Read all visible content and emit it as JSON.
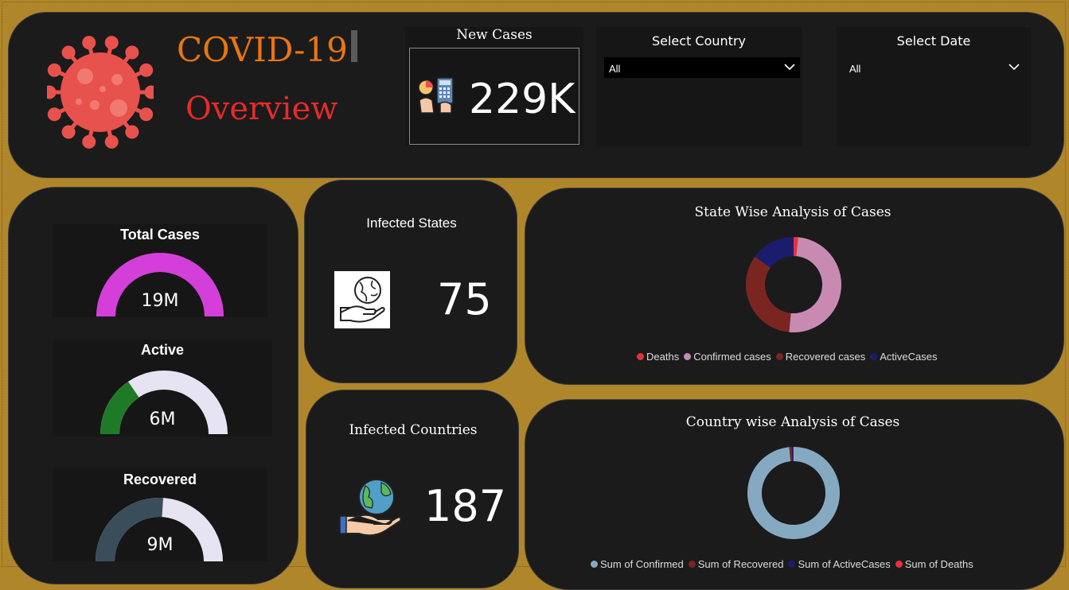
{
  "header": {
    "title": "COVID-19",
    "subtitle": "Overview",
    "title_color": "#e8760f",
    "subtitle_color": "#e52b2b"
  },
  "new_cases": {
    "label": "New Cases",
    "value": "229K",
    "icon": "calculator-chart-icon"
  },
  "slicers": {
    "country": {
      "label": "Select Country",
      "value": "All"
    },
    "date": {
      "label": "Select Date",
      "value": "All"
    }
  },
  "gauges": [
    {
      "label": "Total Cases",
      "value": "19M",
      "fill_fraction": 1.0,
      "fill_color": "#d43fd9",
      "track_color": "#d43fd9"
    },
    {
      "label": "Active",
      "value": "6M",
      "fill_fraction": 0.31,
      "fill_color": "#1f7a28",
      "track_color": "#e6e4f3"
    },
    {
      "label": "Recovered",
      "value": "9M",
      "fill_fraction": 0.52,
      "fill_color": "#3a4d5a",
      "track_color": "#e6e4f3"
    }
  ],
  "infected_states": {
    "label": "Infected States",
    "value": "75",
    "icon": "globe-hand-icon"
  },
  "infected_countries": {
    "label": "Infected Countries",
    "value": "187",
    "icon": "globe-hand-icon"
  },
  "state_chart": {
    "title": "State Wise Analysis of Cases",
    "chart_data": {
      "type": "pie",
      "title": "State Wise Analysis of Cases",
      "labels": [
        "Deaths",
        "Confirmed cases",
        "Recovered cases",
        "ActiveCases"
      ],
      "values": [
        1.5,
        50,
        33.5,
        15
      ],
      "colors": [
        "#e8313a",
        "#c98ab2",
        "#7b2521",
        "#1c1c6e"
      ]
    }
  },
  "country_chart": {
    "title": "Country wise Analysis of Cases",
    "chart_data": {
      "type": "pie",
      "title": "Country wise Analysis of Cases",
      "labels": [
        "Sum of Confirmed",
        "Sum of Recovered",
        "Sum of ActiveCases",
        "Sum of Deaths"
      ],
      "values": [
        98.5,
        0.9,
        0.5,
        0.1
      ],
      "colors": [
        "#86a9c2",
        "#7b2521",
        "#1c1c6e",
        "#e8313a"
      ]
    }
  }
}
